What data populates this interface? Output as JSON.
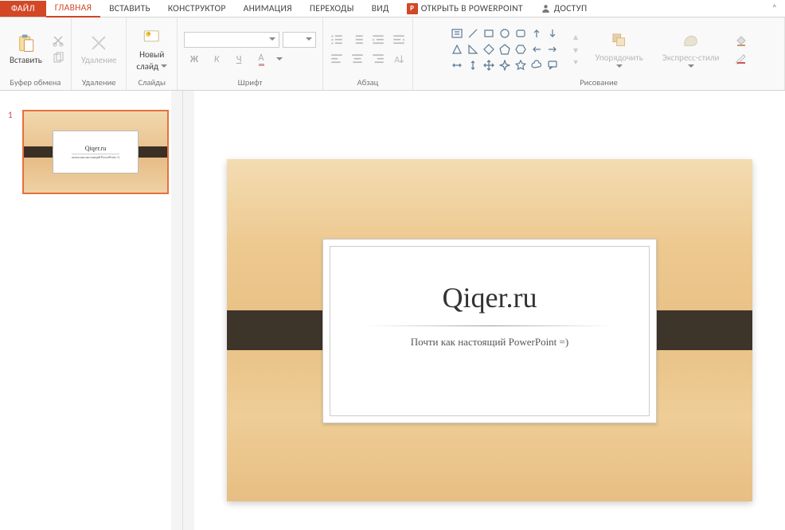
{
  "tabs": {
    "file": "ФАЙЛ",
    "home": "ГЛАВНАЯ",
    "insert": "ВСТАВИТЬ",
    "design": "КОНСТРУКТОР",
    "animation": "АНИМАЦИЯ",
    "transitions": "ПЕРЕХОДЫ",
    "view": "ВИД",
    "open_pp": "ОТКРЫТЬ В POWERPOINT",
    "share": "ДОСТУП"
  },
  "active_tab": "home",
  "groups": {
    "clipboard": {
      "label": "Буфер обмена",
      "paste": "Вставить"
    },
    "delete": {
      "label": "Удаление",
      "btn": "Удаление"
    },
    "slides": {
      "label": "Слайды",
      "btn_l1": "Новый",
      "btn_l2": "слайд"
    },
    "font": {
      "label": "Шрифт",
      "b": "Ж",
      "i": "К",
      "u": "Ч",
      "a": "А"
    },
    "paragraph": {
      "label": "Абзац"
    },
    "drawing": {
      "label": "Рисование",
      "arrange": "Упорядочить",
      "styles": "Экспресс-стили"
    }
  },
  "thumb": {
    "number": "1",
    "title": "Qiqer.ru",
    "subtitle": "почти как настоящий PowerPoint =)"
  },
  "slide": {
    "title": "Qiqer.ru",
    "subtitle": "Почти как настоящий PowerPoint =)"
  }
}
